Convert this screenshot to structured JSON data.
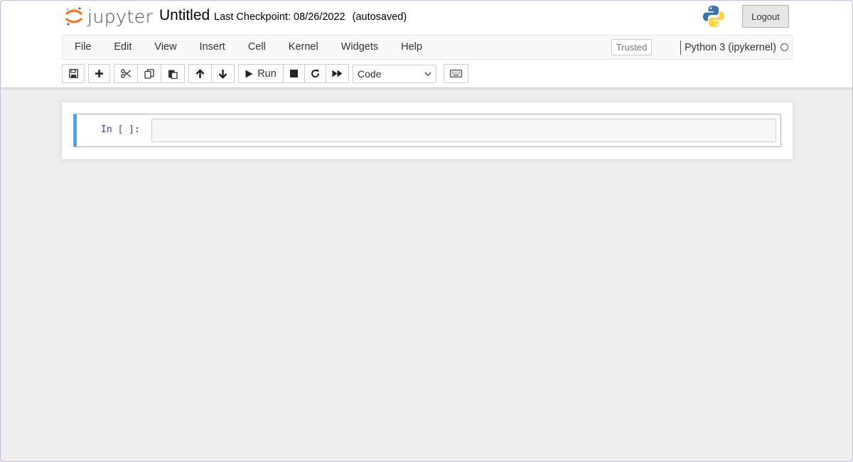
{
  "header": {
    "logo_text": "jupyter",
    "notebook_name": "Untitled",
    "checkpoint_label": "Last Checkpoint: 08/26/2022",
    "autosave_status": "(autosaved)",
    "logout_label": "Logout"
  },
  "menubar": {
    "items": [
      "File",
      "Edit",
      "View",
      "Insert",
      "Cell",
      "Kernel",
      "Widgets",
      "Help"
    ],
    "trusted_label": "Trusted",
    "kernel_name": "Python 3 (ipykernel)"
  },
  "toolbar": {
    "buttons": [
      "save-icon",
      "add-icon",
      "cut-icon",
      "copy-icon",
      "paste-icon",
      "move-up-icon",
      "move-down-icon",
      "run-icon",
      "stop-icon",
      "restart-icon",
      "fast-forward-icon",
      "keyboard-icon"
    ],
    "run_label": "Run",
    "cell_type": "Code"
  },
  "cell": {
    "prompt": "In [ ]:",
    "source": ""
  },
  "colors": {
    "accent_blue": "#42a5f5",
    "jupyter_orange": "#f37726",
    "prompt_blue": "#303f9f"
  }
}
